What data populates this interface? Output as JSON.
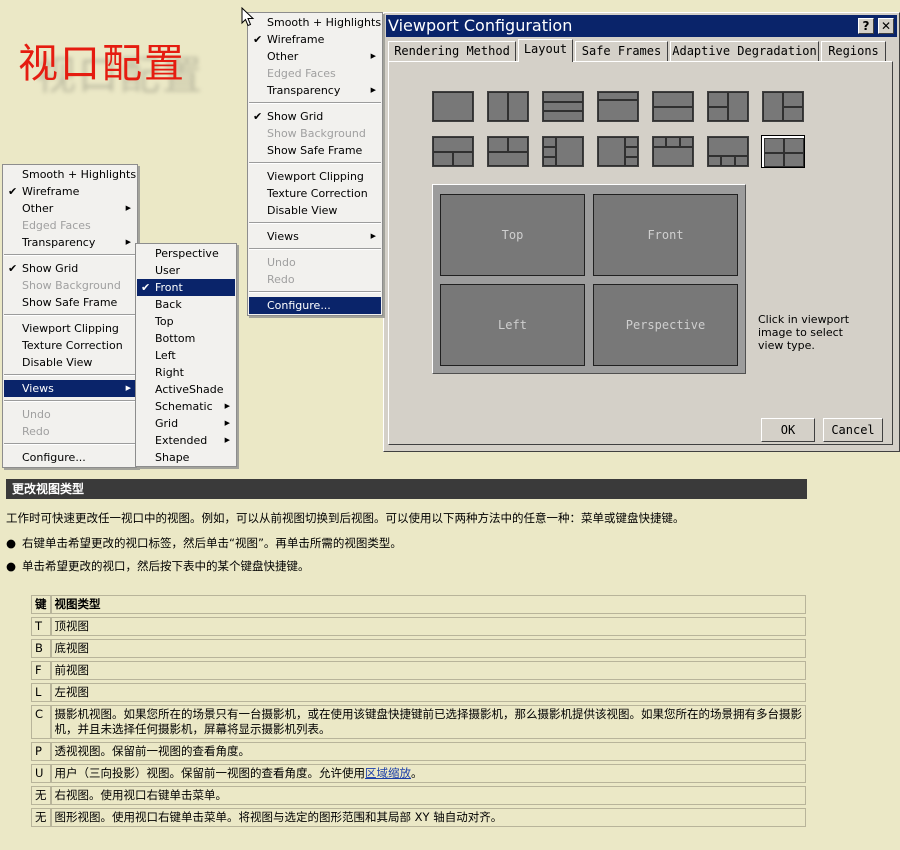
{
  "heading": {
    "title_cn": "视口配置"
  },
  "menu_right": {
    "items": [
      {
        "label": "Smooth + Highlights",
        "check": false,
        "disabled": false,
        "arrow": false
      },
      {
        "label": "Wireframe",
        "check": true,
        "disabled": false,
        "arrow": false
      },
      {
        "label": "Other",
        "check": false,
        "disabled": false,
        "arrow": true
      },
      {
        "label": "Edged Faces",
        "check": false,
        "disabled": true,
        "arrow": false
      },
      {
        "label": "Transparency",
        "check": false,
        "disabled": false,
        "arrow": true
      },
      {
        "label": "Show Grid",
        "check": true,
        "disabled": false,
        "arrow": false
      },
      {
        "label": "Show Background",
        "check": false,
        "disabled": true,
        "arrow": false
      },
      {
        "label": "Show Safe Frame",
        "check": false,
        "disabled": false,
        "arrow": false
      },
      {
        "label": "Viewport Clipping",
        "check": false,
        "disabled": false,
        "arrow": false
      },
      {
        "label": "Texture Correction",
        "check": false,
        "disabled": false,
        "arrow": false
      },
      {
        "label": "Disable View",
        "check": false,
        "disabled": false,
        "arrow": false
      },
      {
        "label": "Views",
        "check": false,
        "disabled": false,
        "arrow": true
      },
      {
        "label": "Undo",
        "check": false,
        "disabled": true,
        "arrow": false
      },
      {
        "label": "Redo",
        "check": false,
        "disabled": true,
        "arrow": false
      },
      {
        "label": "Configure...",
        "check": false,
        "disabled": false,
        "arrow": false,
        "selected": true
      }
    ]
  },
  "menu_left": {
    "items": [
      {
        "label": "Smooth + Highlights",
        "check": false,
        "disabled": false,
        "arrow": false
      },
      {
        "label": "Wireframe",
        "check": true,
        "disabled": false,
        "arrow": false
      },
      {
        "label": "Other",
        "check": false,
        "disabled": false,
        "arrow": true
      },
      {
        "label": "Edged Faces",
        "check": false,
        "disabled": true,
        "arrow": false
      },
      {
        "label": "Transparency",
        "check": false,
        "disabled": false,
        "arrow": true
      },
      {
        "label": "Show Grid",
        "check": true,
        "disabled": false,
        "arrow": false
      },
      {
        "label": "Show Background",
        "check": false,
        "disabled": true,
        "arrow": false
      },
      {
        "label": "Show Safe Frame",
        "check": false,
        "disabled": false,
        "arrow": false
      },
      {
        "label": "Viewport Clipping",
        "check": false,
        "disabled": false,
        "arrow": false
      },
      {
        "label": "Texture Correction",
        "check": false,
        "disabled": false,
        "arrow": false
      },
      {
        "label": "Disable View",
        "check": false,
        "disabled": false,
        "arrow": false
      },
      {
        "label": "Views",
        "check": false,
        "disabled": false,
        "arrow": true,
        "selected": true
      },
      {
        "label": "Undo",
        "check": false,
        "disabled": true,
        "arrow": false
      },
      {
        "label": "Redo",
        "check": false,
        "disabled": true,
        "arrow": false
      },
      {
        "label": "Configure...",
        "check": false,
        "disabled": false,
        "arrow": false
      }
    ]
  },
  "views_submenu": {
    "items": [
      {
        "label": "Perspective",
        "check": false,
        "arrow": false
      },
      {
        "label": "User",
        "check": false,
        "arrow": false
      },
      {
        "label": "Front",
        "check": true,
        "arrow": false,
        "selected": true
      },
      {
        "label": "Back",
        "check": false,
        "arrow": false
      },
      {
        "label": "Top",
        "check": false,
        "arrow": false
      },
      {
        "label": "Bottom",
        "check": false,
        "arrow": false
      },
      {
        "label": "Left",
        "check": false,
        "arrow": false
      },
      {
        "label": "Right",
        "check": false,
        "arrow": false
      },
      {
        "label": "ActiveShade",
        "check": false,
        "arrow": false
      },
      {
        "label": "Schematic",
        "check": false,
        "arrow": true
      },
      {
        "label": "Grid",
        "check": false,
        "arrow": true
      },
      {
        "label": "Extended",
        "check": false,
        "arrow": true
      },
      {
        "label": "Shape",
        "check": false,
        "arrow": false
      }
    ]
  },
  "dialog": {
    "title": "Viewport Configuration",
    "help_button": "?",
    "close_button": "✕",
    "tabs": [
      "Rendering Method",
      "Layout",
      "Safe Frames",
      "Adaptive Degradation",
      "Regions"
    ],
    "active_tab": "Layout",
    "viewports": [
      "Top",
      "Front",
      "Left",
      "Perspective"
    ],
    "hint": "Click in viewport image to select view type.",
    "ok": "OK",
    "cancel": "Cancel"
  },
  "doc": {
    "section_title": "更改视图类型",
    "intro": "工作时可快速更改任一视口中的视图。例如，可以从前视图切换到后视图。可以使用以下两种方法中的任意一种：菜单或键盘快捷键。",
    "bullet1": "右键单击希望更改的视口标签，然后单击“视图”。再单击所需的视图类型。",
    "bullet2": "单击希望更改的视口，然后按下表中的某个键盘快捷键。",
    "bullet_mark": "●",
    "table_head": {
      "key": "键",
      "type": "视图类型"
    },
    "rows": [
      {
        "key": "T",
        "desc": "顶视图"
      },
      {
        "key": "B",
        "desc": "底视图"
      },
      {
        "key": "F",
        "desc": "前视图"
      },
      {
        "key": "L",
        "desc": "左视图"
      },
      {
        "key": "C",
        "desc": "摄影机视图。如果您所在的场景只有一台摄影机，或在使用该键盘快捷键前已选择摄影机，那么摄影机提供该视图。如果您所在的场景拥有多台摄影机，并且未选择任何摄影机，屏幕将显示摄影机列表。"
      },
      {
        "key": "P",
        "desc": "透视视图。保留前一视图的查看角度。"
      },
      {
        "key": "U",
        "desc_before": "用户（三向投影）视图。保留前一视图的查看角度。允许使用",
        "link": "区域缩放",
        "desc_after": "。"
      },
      {
        "key": "无",
        "desc": "右视图。使用视口右键单击菜单。"
      },
      {
        "key": "无",
        "desc": "图形视图。使用视口右键单击菜单。将视图与选定的图形范围和其局部 XY 轴自动对齐。"
      }
    ]
  }
}
